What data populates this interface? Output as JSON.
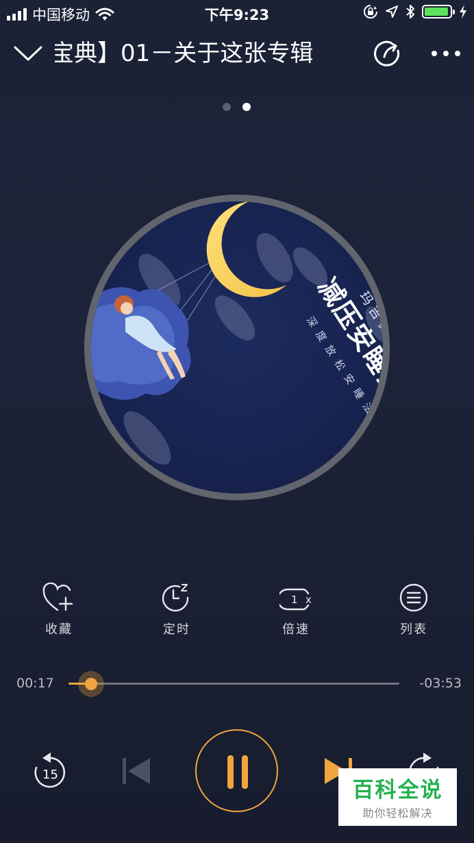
{
  "status_bar": {
    "carrier": "中国移动",
    "time": "下午9:23"
  },
  "header": {
    "title": "宝典】01－关于这张专辑"
  },
  "album": {
    "author": "玛吉薇薇博士",
    "title": "减压安睡宝典",
    "subtitle": "深度放松安睡法"
  },
  "pager": {
    "count": 2,
    "active_index": 1
  },
  "actions": {
    "favorite": "收藏",
    "timer": "定时",
    "speed": "倍速",
    "speed_badge": "1",
    "speed_unit": "x",
    "playlist": "列表"
  },
  "progress": {
    "elapsed": "00:17",
    "remaining": "-03:53",
    "fraction": 0.068
  },
  "controls": {
    "rewind_seconds": "15",
    "forward_seconds": "15"
  },
  "watermark": {
    "main": "百科全说",
    "sub": "助你轻松解决"
  },
  "colors": {
    "accent": "#f0a640",
    "battery": "#5be15b",
    "background": "#1b2236",
    "watermark_green": "#24b14e"
  }
}
